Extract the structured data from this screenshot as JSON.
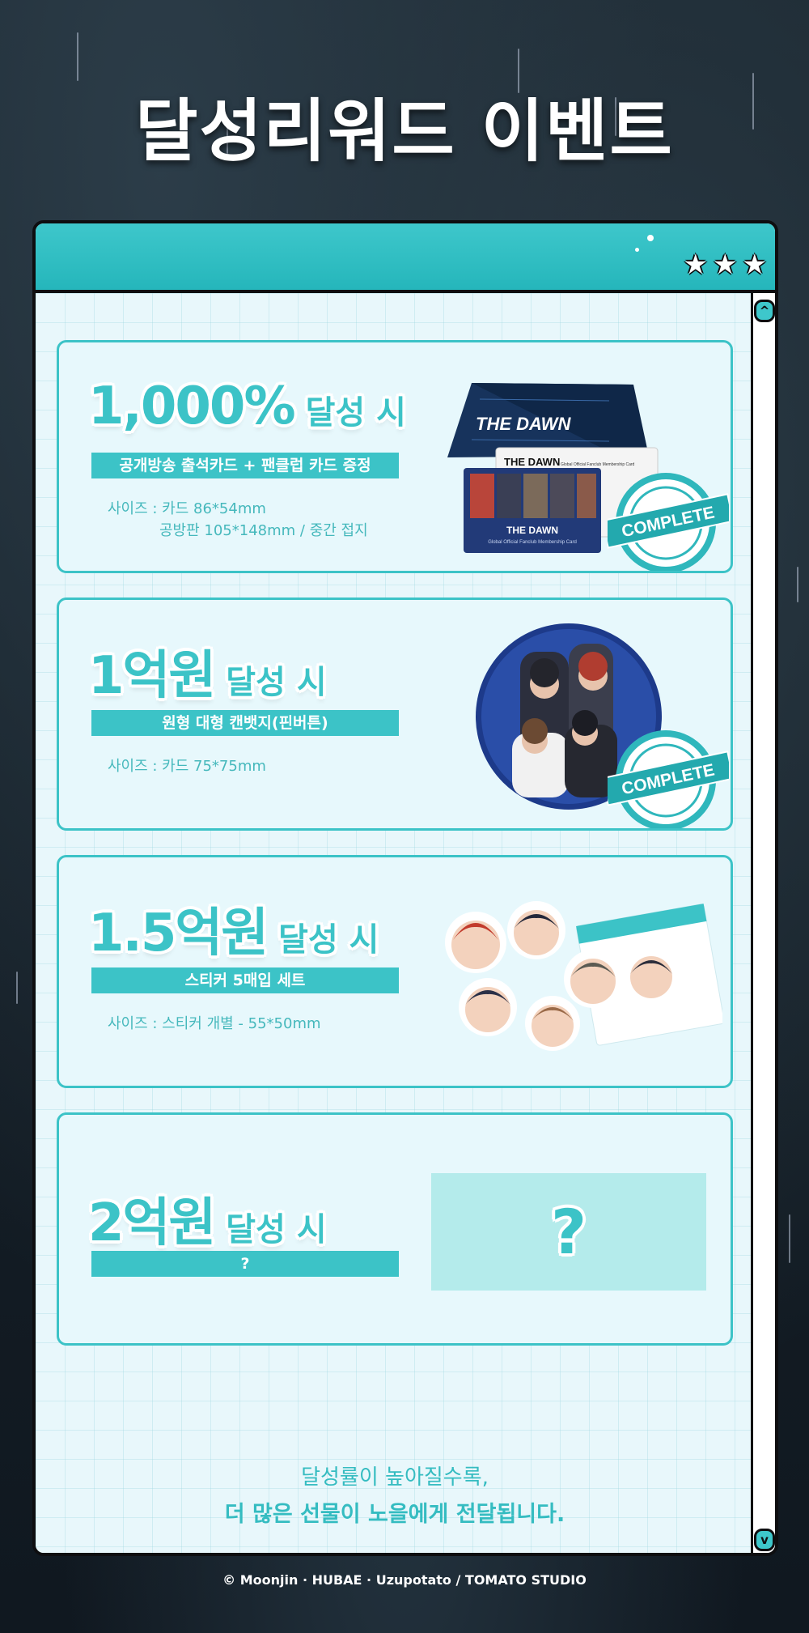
{
  "page_title": "달성리워드 이벤트",
  "window": {
    "star_icon": "★",
    "scroll_up": "^",
    "scroll_down": "v"
  },
  "rewards": [
    {
      "amount": "1,000%",
      "suffix": "달성 시",
      "item": "공개방송 출석카드 + 팬클럽 카드 증정",
      "spec_line1": "사이즈 : 카드 86*54mm",
      "spec_line2": "공방판 105*148mm / 중간 접지",
      "image_text": {
        "folder_title": "THE DAWN",
        "card_title": "THE DAWN",
        "card_subtitle": "Global Official Fanclub Membership Card",
        "card_back_title": "THE DAWN",
        "card_back_sub": "Global Official Fanclub Membership Card"
      },
      "stamp": "COMPLETE"
    },
    {
      "amount": "1억원",
      "suffix": "달성 시",
      "item": "원형 대형 캔뱃지(핀버튼)",
      "spec_line1": "사이즈 : 카드 75*75mm",
      "stamp": "COMPLETE"
    },
    {
      "amount": "1.5억원",
      "suffix": "달성 시",
      "item": "스티커 5매입 세트",
      "spec_line1": "사이즈 : 스티커 개별 - 55*50mm"
    },
    {
      "amount": "2억원",
      "suffix": "달성 시",
      "item": "?",
      "mystery": "?"
    }
  ],
  "footer": {
    "line1": "달성률이 높아질수록,",
    "line2": "더 많은 선물이 노을에게 전달됩니다."
  },
  "credits": "© Moonjin · HUBAE · Uzupotato / TOMATO STUDIO",
  "colors": {
    "accent": "#3cc3c7",
    "window_bg": "#e8f7fb",
    "background": "#1a252e"
  }
}
